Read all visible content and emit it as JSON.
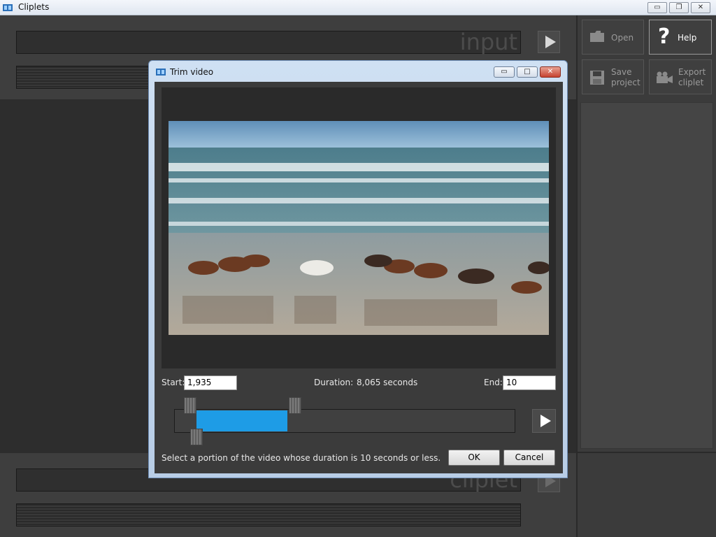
{
  "window": {
    "title": "Cliplets",
    "minimize_glyph": "▭",
    "restore_glyph": "❐",
    "close_glyph": "✕"
  },
  "workspace": {
    "input_label": "input",
    "cliplet_label": "cliplet"
  },
  "side_buttons": {
    "open": "Open",
    "help": "Help",
    "save_line1": "Save",
    "save_line2": "project",
    "export_line1": "Export",
    "export_line2": "cliplet"
  },
  "dialog": {
    "title": "Trim video",
    "minimize_glyph": "▭",
    "maximize_glyph": "□",
    "close_glyph": "✕",
    "start_label": "Start:",
    "start_value": "1,935",
    "duration_label": "Duration:",
    "duration_value": "8,065 seconds",
    "end_label": "End:",
    "end_value": "10",
    "hint": "Select a portion of the video whose duration is 10 seconds or less.",
    "ok": "OK",
    "cancel": "Cancel"
  },
  "colors": {
    "accent": "#1e9ce6",
    "dialog_frame": "#b8cde6",
    "dark_bg": "#3b3b3b"
  },
  "icons": [
    "app-icon",
    "folder-icon",
    "question-icon",
    "floppy-disk-icon",
    "video-camera-icon",
    "play-icon"
  ]
}
